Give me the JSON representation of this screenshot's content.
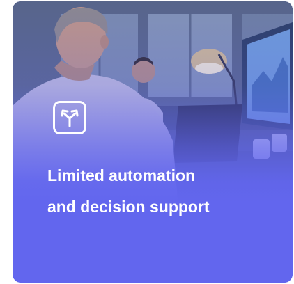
{
  "card": {
    "title_line1": "Limited automation",
    "title_line2": "and decision support",
    "icon": "split-arrows-icon",
    "background_image": "office-workers-at-monitors-photo"
  },
  "colors": {
    "accent": "#6266ee",
    "text": "#ffffff",
    "page_background": "#ffffff"
  }
}
